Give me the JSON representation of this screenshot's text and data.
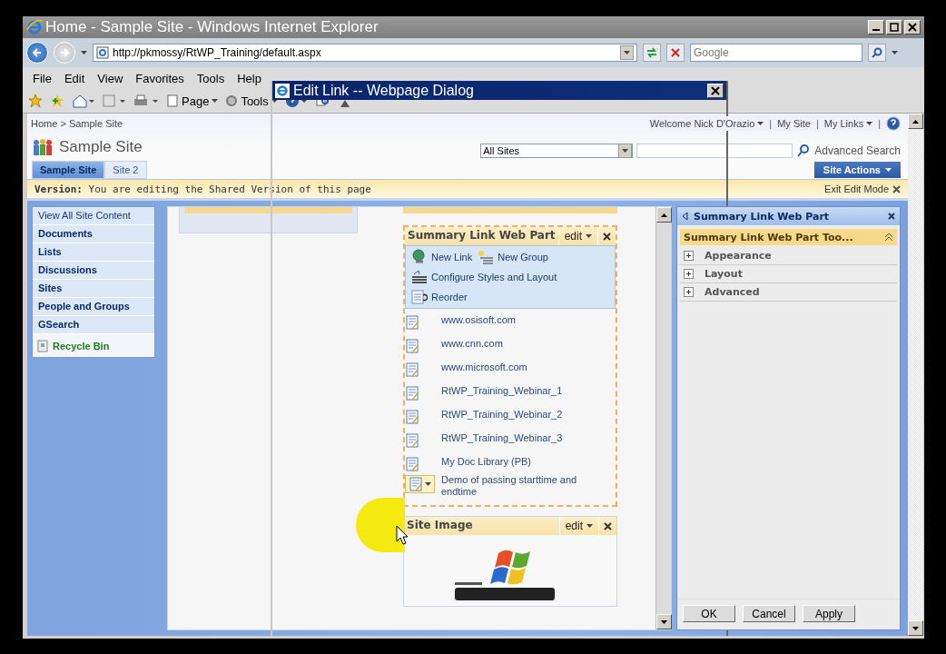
{
  "browser": {
    "title": "Home - Sample Site - Windows Internet Explorer",
    "address": "http://pkmossy/RtWP_Training/default.aspx",
    "search_placeholder": "Google",
    "menu": [
      "File",
      "Edit",
      "View",
      "Favorites",
      "Tools",
      "Help"
    ],
    "toolbar": [
      "Page",
      "Tools"
    ]
  },
  "dialog": {
    "title": "Edit Link -- Webpage Dialog"
  },
  "site": {
    "breadcrumb": "Home > Sample Site",
    "welcome": "Welcome Nick D'Orazio",
    "separator": "|",
    "top_links": [
      "My Site",
      "My Links"
    ],
    "title": "Sample Site",
    "tabs": [
      {
        "label": "Sample Site",
        "selected": true
      },
      {
        "label": "Site 2",
        "selected": false
      }
    ],
    "scope": "All Sites",
    "advanced_search": "Advanced Search",
    "site_actions": "Site Actions"
  },
  "version_bar": {
    "message": "**Version:** You are editing the Shared Version of this page",
    "exit": "Exit Edit Mode"
  },
  "quick_launch": [
    {
      "label": "View All Site Content",
      "kind": "plain"
    },
    {
      "label": "Documents",
      "kind": "heading"
    },
    {
      "label": "Lists",
      "kind": "heading"
    },
    {
      "label": "Discussions",
      "kind": "heading"
    },
    {
      "label": "Sites",
      "kind": "heading"
    },
    {
      "label": "People and Groups",
      "kind": "heading"
    },
    {
      "label": "GSearch",
      "kind": "heading"
    },
    {
      "label": "Recycle Bin",
      "kind": "recycle"
    }
  ],
  "summary_web_part": {
    "title": "Summary Link Web Part",
    "menu": "edit",
    "actions": [
      {
        "label": "New Link",
        "kind": "link"
      },
      {
        "label": "New Group",
        "kind": "group"
      },
      {
        "label": "Configure Styles and Layout",
        "kind": "styles"
      },
      {
        "label": "Reorder",
        "kind": "reorder"
      }
    ],
    "links": [
      {
        "label": "www.osisoft.com",
        "selected": false
      },
      {
        "label": "www.cnn.com",
        "selected": false
      },
      {
        "label": "www.microsoft.com",
        "selected": false
      },
      {
        "label": "RtWP_Training_Webinar_1",
        "selected": false
      },
      {
        "label": "RtWP_Training_Webinar_2",
        "selected": false
      },
      {
        "label": "RtWP_Training_Webinar_3",
        "selected": false
      },
      {
        "label": "My Doc Library (PB)",
        "selected": false
      },
      {
        "label": "Demo of passing starttime and endtime",
        "selected": true
      }
    ]
  },
  "image_web_part": {
    "title": "Site Image",
    "menu": "edit"
  },
  "tool_pane": {
    "title": "Summary Link Web Part",
    "section": "Summary Link Web Part Too...",
    "groups": [
      {
        "label": "Appearance",
        "expanded": false
      },
      {
        "label": "Layout",
        "expanded": false
      },
      {
        "label": "Advanced",
        "expanded": false
      }
    ],
    "buttons": [
      "OK",
      "Cancel",
      "Apply"
    ]
  }
}
